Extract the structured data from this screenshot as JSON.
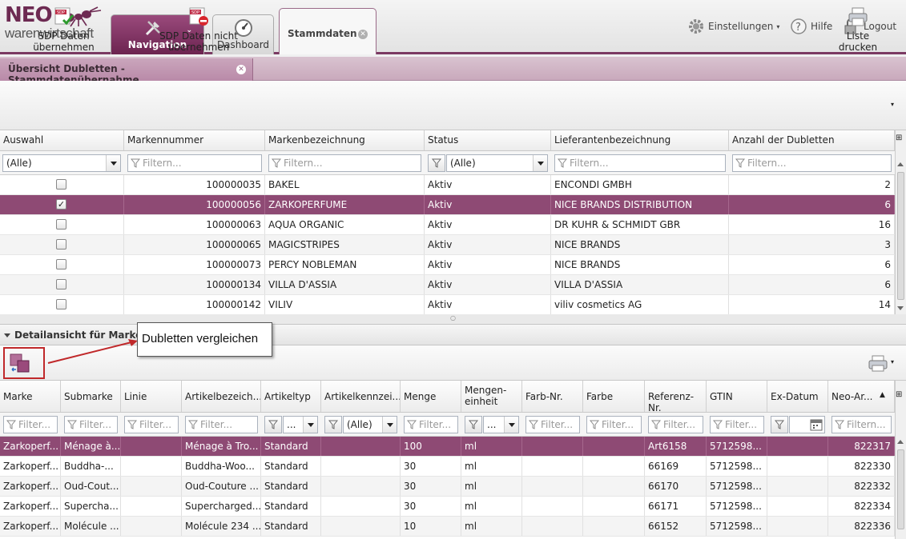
{
  "app": {
    "logo_top": "NEO",
    "logo_bottom": "warenwirtschaft"
  },
  "tabs": {
    "navigation": "Navigation",
    "dashboard": "Dashboard",
    "stammdaten": "Stammdaten"
  },
  "top_right": {
    "settings": "Einstellungen",
    "help": "Hilfe",
    "logout": "Logout"
  },
  "subtab": {
    "label": "Übersicht Dubletten - Stammdatenübernahme"
  },
  "toolbar": {
    "take_label": "SDP Daten übernehmen",
    "reject_label": "SDP Daten nicht übernehmen",
    "print_label": "Liste drucken",
    "sdp_badge": "SDP"
  },
  "upper_grid": {
    "columns": [
      "Auswahl",
      "Markennummer",
      "Markenbezeichnung",
      "Status",
      "Lieferantenbezeichnung",
      "Anzahl der Dubletten"
    ],
    "filter_all": "(Alle)",
    "filter_placeholder": "Filtern...",
    "rows": [
      {
        "checked": false,
        "nr": "100000035",
        "name": "BAKEL",
        "status": "Aktiv",
        "supplier": "ENCONDI GMBH",
        "count": "2"
      },
      {
        "checked": true,
        "nr": "100000056",
        "name": "ZARKOPERFUME",
        "status": "Aktiv",
        "supplier": "NICE BRANDS DISTRIBUTION",
        "count": "6"
      },
      {
        "checked": false,
        "nr": "100000063",
        "name": "AQUA ORGANIC",
        "status": "Aktiv",
        "supplier": "DR KUHR & SCHMIDT GBR",
        "count": "16"
      },
      {
        "checked": false,
        "nr": "100000065",
        "name": "MAGICSTRIPES",
        "status": "Aktiv",
        "supplier": "NICE BRANDS",
        "count": "3"
      },
      {
        "checked": false,
        "nr": "100000073",
        "name": "PERCY NOBLEMAN",
        "status": "Aktiv",
        "supplier": "NICE BRANDS",
        "count": "6"
      },
      {
        "checked": false,
        "nr": "100000134",
        "name": "VILLA D'ASSIA",
        "status": "Aktiv",
        "supplier": "VILLA D'ASSIA",
        "count": "6"
      },
      {
        "checked": false,
        "nr": "100000142",
        "name": "VILIV",
        "status": "Aktiv",
        "supplier": "viliv cosmetics AG",
        "count": "14"
      }
    ]
  },
  "detail": {
    "header": "Detailansicht für Marke: Z",
    "callout": "Dubletten vergleichen"
  },
  "lower_grid": {
    "columns": [
      "Marke",
      "Submarke",
      "Linie",
      "Artikelbezeich...",
      "Artikeltyp",
      "Artikelkennzei...",
      "Menge",
      "Mengen-\neinheit",
      "Farb-Nr.",
      "Farbe",
      "Referenz-Nr.",
      "GTIN",
      "Ex-Datum",
      "Neo-Ar..."
    ],
    "filter_placeholder": "Filter...",
    "filter_placeholder_long": "Filtern...",
    "filter_all": "(Alle)",
    "filter_dots": "...",
    "rows": [
      {
        "marke": "Zarkoperf...",
        "sub": "Ménage à...",
        "linie": "",
        "bez": "Ménage à Tro...",
        "typ": "Standard",
        "kenn": "",
        "menge": "100",
        "einheit": "ml",
        "farbnr": "",
        "farbe": "",
        "ref": "Art6158",
        "gtin": "5712598...",
        "ex": "",
        "neo": "822317"
      },
      {
        "marke": "Zarkoperf...",
        "sub": "Buddha-...",
        "linie": "",
        "bez": "Buddha-Woo...",
        "typ": "Standard",
        "kenn": "",
        "menge": "30",
        "einheit": "ml",
        "farbnr": "",
        "farbe": "",
        "ref": "66169",
        "gtin": "5712598...",
        "ex": "",
        "neo": "822330"
      },
      {
        "marke": "Zarkoperf...",
        "sub": "Oud-Cout...",
        "linie": "",
        "bez": "Oud-Couture ...",
        "typ": "Standard",
        "kenn": "",
        "menge": "30",
        "einheit": "ml",
        "farbnr": "",
        "farbe": "",
        "ref": "66170",
        "gtin": "5712598...",
        "ex": "",
        "neo": "822332"
      },
      {
        "marke": "Zarkoperf...",
        "sub": "Supercha...",
        "linie": "",
        "bez": "Supercharged...",
        "typ": "Standard",
        "kenn": "",
        "menge": "30",
        "einheit": "ml",
        "farbnr": "",
        "farbe": "",
        "ref": "66171",
        "gtin": "5712598...",
        "ex": "",
        "neo": "822334"
      },
      {
        "marke": "Zarkoperf...",
        "sub": "Molécule ...",
        "linie": "",
        "bez": "Molécule 234 ...",
        "typ": "Standard",
        "kenn": "",
        "menge": "10",
        "einheit": "ml",
        "farbnr": "",
        "farbe": "",
        "ref": "66152",
        "gtin": "5712598...",
        "ex": "",
        "neo": "822336"
      }
    ]
  },
  "colors": {
    "brand": "#7b3a62",
    "selected_row": "#8e4a74",
    "callout_arrow": "#c0282a"
  }
}
